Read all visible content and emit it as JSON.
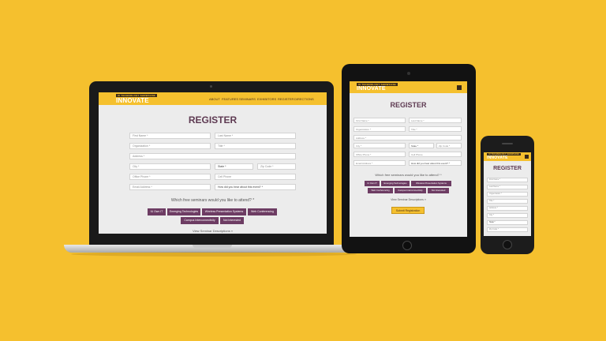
{
  "brand": {
    "tagline": "IU TECHNOLOGY SHOWCASE",
    "name": "INNOVATE",
    "accent": "#f5c02e",
    "title_color": "#5e3a52",
    "button_color": "#6d3c63"
  },
  "nav": [
    "ABOUT",
    "FEATURES",
    "SEMINARS",
    "EXHIBITORS",
    "REGISTER",
    "DIRECTIONS"
  ],
  "form": {
    "title": "REGISTER",
    "first_name": "First Name *",
    "last_name": "Last Name *",
    "organization": "Organization *",
    "title_field": "Title *",
    "address": "Address *",
    "city": "City *",
    "state": "State *",
    "zip": "Zip Code *",
    "office_phone": "Office Phone *",
    "cell_phone": "Cell Phone",
    "email": "Email Address *",
    "heard": "How did you hear about this event? *",
    "question": "Which free seminars would you like to attend? *",
    "seminars": [
      "IU Own IT",
      "Emerging Technologies",
      "Wireless Presentation Systems",
      "Web Conferencing",
      "Campus Interconnectivity",
      "Not Interested"
    ],
    "descriptions_link": "View Seminar Descriptions »",
    "submit": "Submit Registration"
  }
}
